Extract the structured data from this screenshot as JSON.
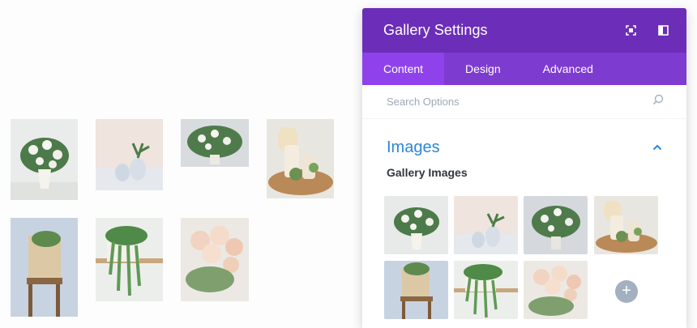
{
  "panel": {
    "title": "Gallery Settings",
    "tabs": [
      {
        "label": "Content"
      },
      {
        "label": "Design"
      },
      {
        "label": "Advanced"
      }
    ],
    "search": {
      "placeholder": "Search Options"
    },
    "section": {
      "title": "Images"
    },
    "field": {
      "label": "Gallery Images"
    },
    "add_label": "+"
  },
  "colors": {
    "header": "#6c2eb9",
    "tabs": "#7e3bd0",
    "active_tab": "#8f42ec",
    "section_title": "#2b87da"
  },
  "icons": [
    "fullscreen-icon",
    "split-view-icon",
    "search-icon",
    "chevron-up-icon",
    "add-icon"
  ]
}
